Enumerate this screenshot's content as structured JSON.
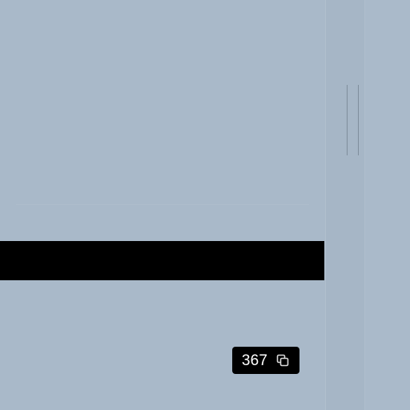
{
  "app": {
    "background_color": "#a9b9c9",
    "rail_color": "#a6b6c6"
  },
  "media": {
    "redacted_region": {
      "color": "#000000"
    },
    "count_badge": {
      "value": "367",
      "icon": "copy-stack-icon"
    }
  }
}
